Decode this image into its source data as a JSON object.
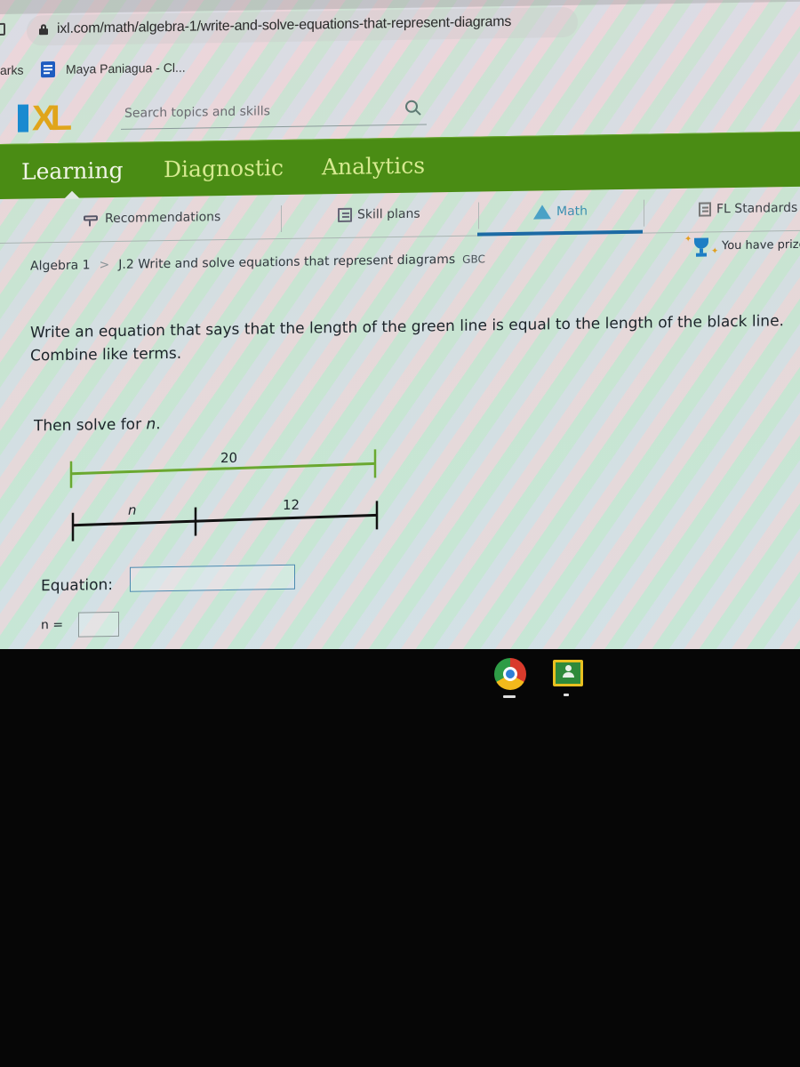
{
  "browser": {
    "url": "ixl.com/math/algebra-1/write-and-solve-equations-that-represent-diagrams",
    "bookmarks_label": "arks",
    "bookmark_item": "Maya Paniagua - Cl..."
  },
  "header": {
    "logo_text": "XL",
    "search_placeholder": "Search topics and skills"
  },
  "topnav": {
    "items": [
      {
        "label": "Learning",
        "active": true
      },
      {
        "label": "Diagnostic",
        "active": false
      },
      {
        "label": "Analytics",
        "active": false
      }
    ]
  },
  "subnav": {
    "items": [
      {
        "label": "Recommendations",
        "icon": "recommendations-icon"
      },
      {
        "label": "Skill plans",
        "icon": "skill-plans-icon"
      },
      {
        "label": "Math",
        "icon": "math-pyramid-icon",
        "active": true
      },
      {
        "label": "FL Standards",
        "icon": "standards-clipboard-icon"
      }
    ]
  },
  "breadcrumb": {
    "course": "Algebra 1",
    "skill": "J.2 Write and solve equations that represent diagrams",
    "code": "GBC"
  },
  "prize": {
    "text": "You have prize"
  },
  "question": {
    "prompt": "Write an equation that says that the length of the green line is equal to the length of the black line. Combine like terms.",
    "solve_prefix": "Then solve for ",
    "variable": "n",
    "solve_suffix": ".",
    "diagram": {
      "green_line_label": "20",
      "black_segments": [
        {
          "label": "n"
        },
        {
          "label": "12"
        }
      ],
      "colors": {
        "green": "#6aa830",
        "black": "#111111"
      }
    },
    "equation_label": "Equation:",
    "equation_value": "",
    "answer_label": "n =",
    "answer_value": ""
  },
  "shelf": {
    "apps": [
      "Chrome",
      "Google Classroom"
    ]
  },
  "colors": {
    "ixl_green": "#4a8c14",
    "ixl_blue": "#1a8ad0",
    "ixl_gold": "#e0a51b",
    "active_tab_underline": "#1c6aa4"
  }
}
